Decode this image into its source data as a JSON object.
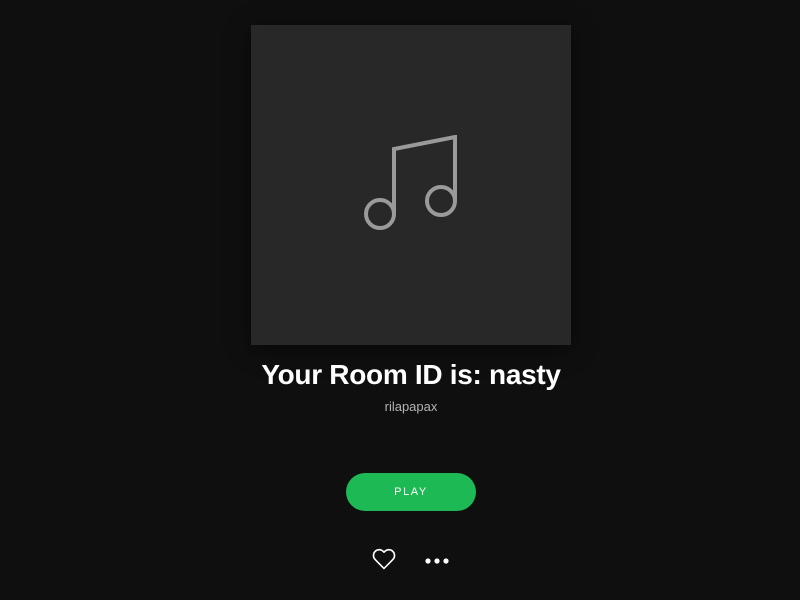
{
  "playlist": {
    "cover_icon": "music-note-icon",
    "title": "Your Room ID is: nasty",
    "owner": "rilapapax"
  },
  "actions": {
    "play_label": "PLAY",
    "like_icon": "heart-icon",
    "more_icon": "more-options-icon"
  },
  "colors": {
    "background": "#0f0f0f",
    "cover_background": "#282828",
    "accent": "#1db954",
    "title_text": "#ffffff",
    "secondary_text": "#b3b3b3"
  }
}
